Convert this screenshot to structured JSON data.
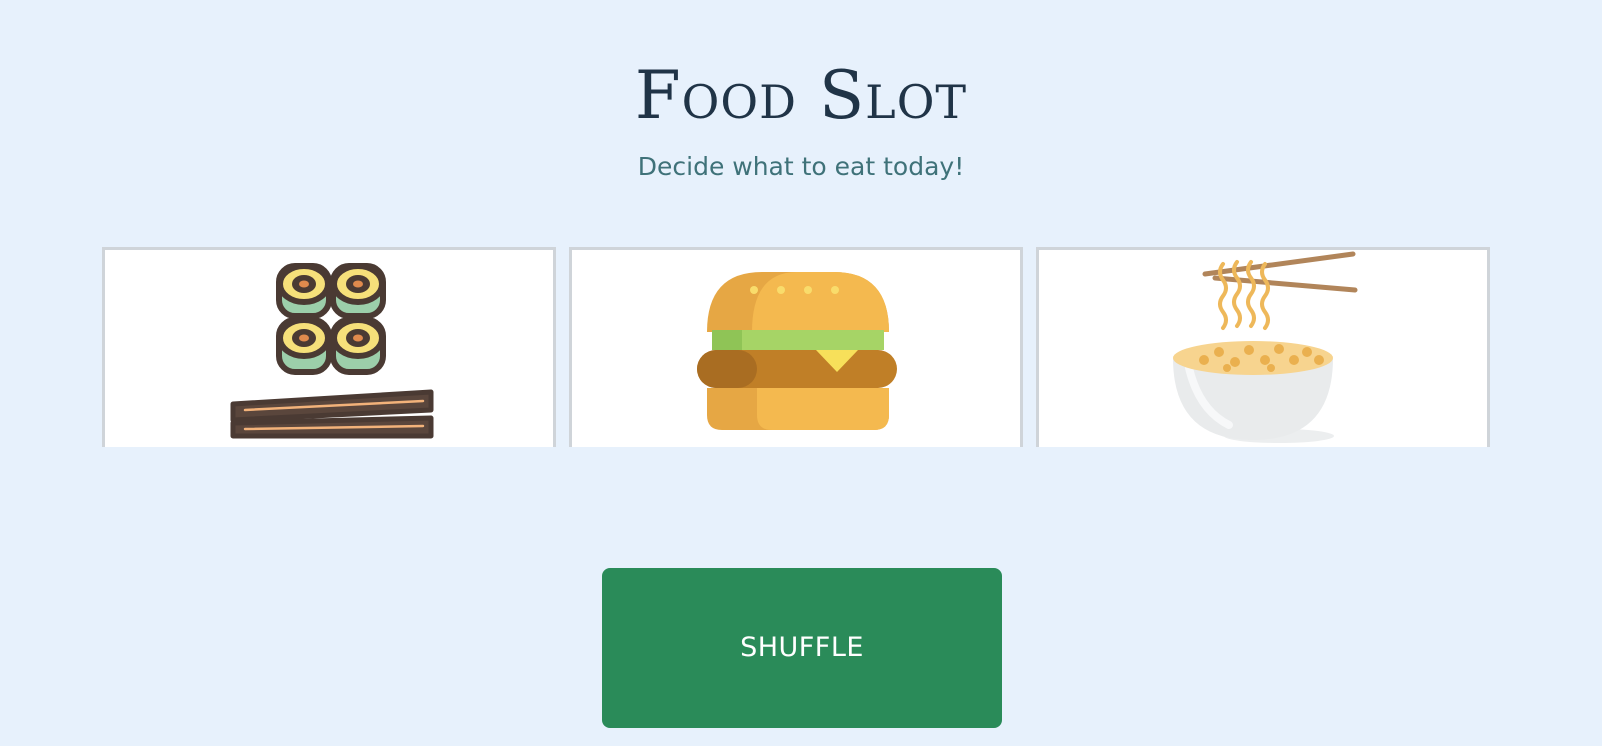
{
  "header": {
    "title": "Food Slot",
    "subtitle": "Decide what to eat today!"
  },
  "slots": [
    {
      "icon": "sushi-icon"
    },
    {
      "icon": "burger-icon"
    },
    {
      "icon": "noodles-icon"
    }
  ],
  "shuffle": {
    "label": "SHUFFLE"
  },
  "colors": {
    "background": "#e7f1fc",
    "title": "#203447",
    "subtitle": "#3f7279",
    "button": "#2a8b59",
    "slot_border": "#cfd4d9"
  }
}
